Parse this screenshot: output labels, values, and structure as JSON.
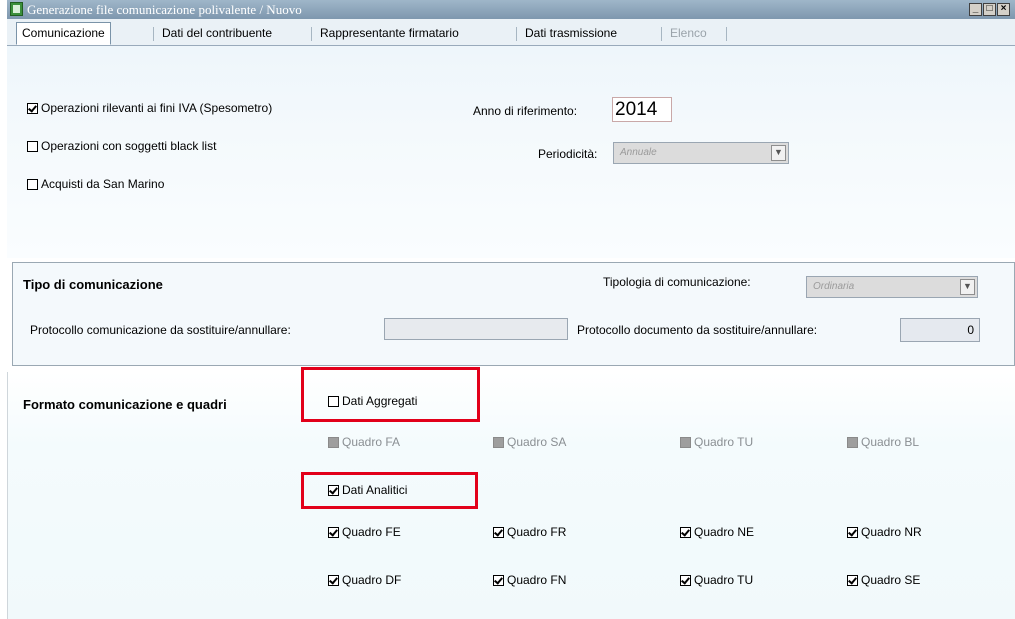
{
  "window": {
    "title": "Generazione file comunicazione polivalente / Nuovo",
    "controls": {
      "minimize": "_",
      "maximize": "□",
      "close": "×"
    }
  },
  "tabs": [
    {
      "label": "Comunicazione",
      "active": true
    },
    {
      "label": "Dati del contribuente"
    },
    {
      "label": "Rappresentante firmatario"
    },
    {
      "label": "Dati trasmissione"
    },
    {
      "label": "Elenco",
      "disabled": true
    }
  ],
  "comunicazione": {
    "checkboxes": [
      {
        "label": "Operazioni rilevanti ai fini IVA (Spesometro)",
        "checked": true
      },
      {
        "label": "Operazioni con soggetti black list",
        "checked": false
      },
      {
        "label": "Acquisti da San Marino",
        "checked": false
      }
    ],
    "anno_label": "Anno di riferimento:",
    "anno_value": "2014",
    "periodicita_label": "Periodicità:",
    "periodicita_value": "Annuale"
  },
  "tipo": {
    "heading": "Tipo di comunicazione",
    "tipologia_label": "Tipologia di comunicazione:",
    "tipologia_value": "Ordinaria",
    "protocollo_comunicazione_label": "Protocollo comunicazione da sostituire/annullare:",
    "protocollo_comunicazione_value": "",
    "protocollo_documento_label": "Protocollo documento da sostituire/annullare:",
    "protocollo_documento_value": "0"
  },
  "formato": {
    "heading": "Formato comunicazione e quadri",
    "dati_aggregati": {
      "label": "Dati Aggregati",
      "checked": false
    },
    "aggregati_quadri": [
      {
        "label": "Quadro FA",
        "checked": false
      },
      {
        "label": "Quadro SA",
        "checked": false
      },
      {
        "label": "Quadro TU",
        "checked": false
      },
      {
        "label": "Quadro BL",
        "checked": false
      }
    ],
    "dati_analitici": {
      "label": "Dati Analitici",
      "checked": true
    },
    "analitici_row1": [
      {
        "label": "Quadro FE",
        "checked": true
      },
      {
        "label": "Quadro FR",
        "checked": true
      },
      {
        "label": "Quadro NE",
        "checked": true
      },
      {
        "label": "Quadro NR",
        "checked": true
      }
    ],
    "analitici_row2": [
      {
        "label": "Quadro DF",
        "checked": true
      },
      {
        "label": "Quadro FN",
        "checked": true
      },
      {
        "label": "Quadro TU",
        "checked": true
      },
      {
        "label": "Quadro SE",
        "checked": true
      }
    ]
  },
  "colors": {
    "highlight": "#e2001a",
    "titlebar": "#8ba3b8",
    "panel": "#f4f9fc"
  }
}
